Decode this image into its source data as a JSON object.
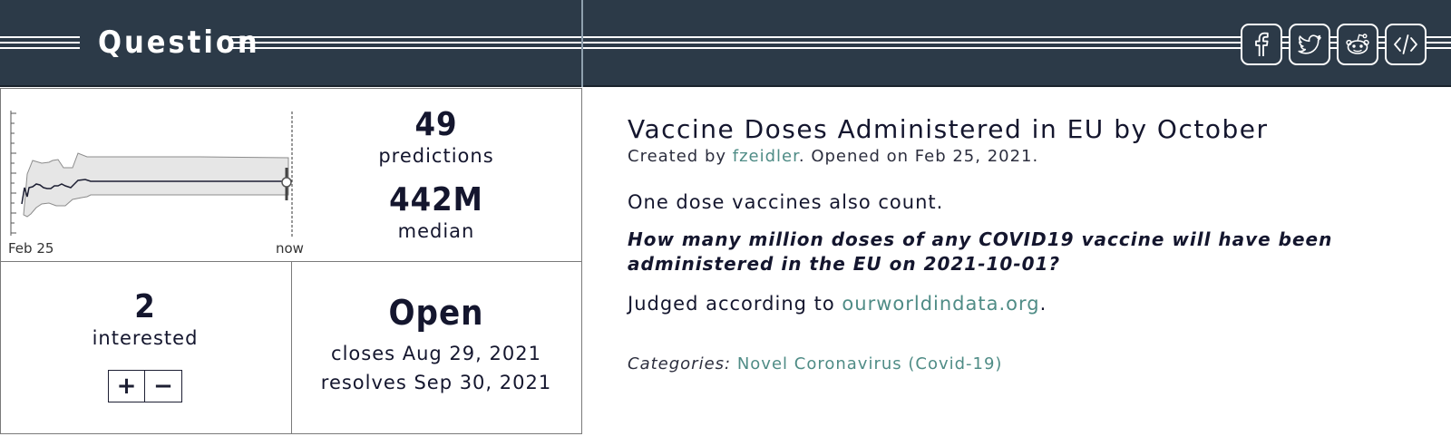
{
  "header": {
    "title": "Question",
    "share_buttons": [
      {
        "name": "facebook-share-button",
        "icon": "facebook-icon"
      },
      {
        "name": "twitter-share-button",
        "icon": "twitter-icon"
      },
      {
        "name": "reddit-share-button",
        "icon": "reddit-icon"
      },
      {
        "name": "embed-button",
        "icon": "code-icon"
      }
    ]
  },
  "stats": {
    "chart": {
      "x_start_label": "Feb 25",
      "x_end_label": "now"
    },
    "predictions_count": "49",
    "predictions_label": "predictions",
    "median_value": "442M",
    "median_label": "median",
    "interested_count": "2",
    "interested_label": "interested",
    "vote_up": "+",
    "vote_down": "−",
    "status": "Open",
    "closes": "closes Aug 29, 2021",
    "resolves": "resolves Sep 30, 2021"
  },
  "question": {
    "title": "Vaccine Doses Administered in EU by October",
    "created_by_prefix": "Created by ",
    "author": "fzeidler",
    "opened_text": ". Opened on Feb 25, 2021.",
    "note": "One dose vaccines also count.",
    "question_text": "How many million doses of any COVID19 vaccine will have been administered in the EU on 2021-10-01?",
    "judged_prefix": "Judged according to ",
    "judged_link": "ourworldindata.org",
    "judged_suffix": ".",
    "categories_label": "Categories:",
    "category": "Novel Coronavirus (Covid-19)"
  },
  "colors": {
    "header_bg": "#2c3a48",
    "link": "#4f8c86",
    "text": "#14162e"
  }
}
